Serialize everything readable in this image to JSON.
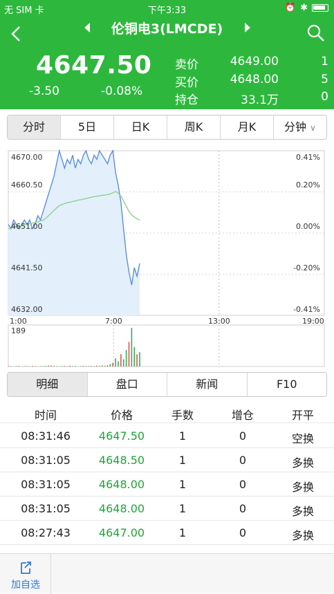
{
  "status_bar": {
    "carrier": "无 SIM 卡",
    "time": "下午3:33"
  },
  "header": {
    "title": "伦铜电3(LMCDE)",
    "last_price": "4647.50",
    "change": "-3.50",
    "change_pct": "-0.08%",
    "quotes": [
      {
        "label": "卖价",
        "price": "4649.00",
        "qty": "1"
      },
      {
        "label": "买价",
        "price": "4648.00",
        "qty": "5"
      },
      {
        "label": "持仓",
        "price": "33.1万",
        "qty": "0"
      }
    ]
  },
  "period_tabs": [
    "分时",
    "5日",
    "日K",
    "周K",
    "月K",
    "分钟"
  ],
  "chart_labels": {
    "price_ticks": [
      "4670.00",
      "4660.50",
      "4651.00",
      "4641.50",
      "4632.00"
    ],
    "pct_ticks": [
      "0.41%",
      "0.20%",
      "0.00%",
      "-0.20%",
      "-0.41%"
    ],
    "time_ticks": [
      "1:00",
      "7:00",
      "13:00",
      "19:00"
    ],
    "volume_max": "189"
  },
  "chart_data": {
    "type": "line",
    "x_range": [
      "1:00",
      "19:00"
    ],
    "ylim": [
      4632.0,
      4670.0
    ],
    "series": [
      {
        "values": [
          4653,
          4652,
          4654,
          4653,
          4652,
          4653,
          4654,
          4653,
          4654,
          4652,
          4653,
          4655,
          4654,
          4656,
          4658,
          4660,
          4662,
          4664,
          4667,
          4670,
          4668,
          4666,
          4668,
          4667,
          4669,
          4666,
          4668,
          4667,
          4669,
          4670,
          4668,
          4667,
          4669,
          4668,
          4670,
          4669,
          4668,
          4667,
          4669,
          4670,
          4665,
          4662,
          4658,
          4652,
          4646,
          4642,
          4639,
          4643,
          4641,
          4644
        ]
      },
      {
        "values": [
          4652,
          4652,
          4652.5,
          4652.5,
          4652.5,
          4652.8,
          4653,
          4653,
          4653.2,
          4653.3,
          4653.4,
          4653.6,
          4653.8,
          4654,
          4654.4,
          4655,
          4655.6,
          4656.2,
          4656.8,
          4657.3,
          4657.6,
          4657.8,
          4658,
          4658.1,
          4658.3,
          4658.4,
          4658.6,
          4658.7,
          4658.8,
          4659,
          4659.1,
          4659.3,
          4659.4,
          4659.5,
          4659.6,
          4659.7,
          4659.8,
          4659.9,
          4660,
          4660.3,
          4660.6,
          4660.2,
          4659.5,
          4658.4,
          4657.2,
          4656,
          4655.2,
          4654.7,
          4654.3,
          4654
        ]
      }
    ],
    "volume": [
      3,
      2,
      1,
      2,
      3,
      1,
      2,
      2,
      1,
      3,
      2,
      1,
      2,
      2,
      3,
      4,
      5,
      3,
      2,
      1,
      2,
      3,
      2,
      4,
      2,
      3,
      1,
      2,
      3,
      2,
      2,
      3,
      2,
      4,
      3,
      5,
      4,
      6,
      12,
      18,
      40,
      25,
      60,
      35,
      80,
      120,
      189,
      95,
      60,
      70
    ]
  },
  "info_tabs": [
    "明细",
    "盘口",
    "新闻",
    "F10"
  ],
  "table": {
    "headers": [
      "时间",
      "价格",
      "手数",
      "增仓",
      "开平"
    ],
    "rows": [
      [
        "08:31:46",
        "4647.50",
        "1",
        "0",
        "空换"
      ],
      [
        "08:31:05",
        "4648.50",
        "1",
        "0",
        "多换"
      ],
      [
        "08:31:05",
        "4648.00",
        "1",
        "0",
        "多换"
      ],
      [
        "08:31:05",
        "4648.00",
        "1",
        "0",
        "多换"
      ],
      [
        "08:27:43",
        "4647.00",
        "1",
        "0",
        "多换"
      ]
    ]
  },
  "bottom_bar": {
    "favorite_label": "加自选"
  },
  "colors": {
    "header_green": "#2db83d",
    "price_green": "#21a33a",
    "line_blue": "#5b8fdc",
    "avg_green": "#8fcf8f",
    "fav_blue": "#2a7bd8"
  }
}
